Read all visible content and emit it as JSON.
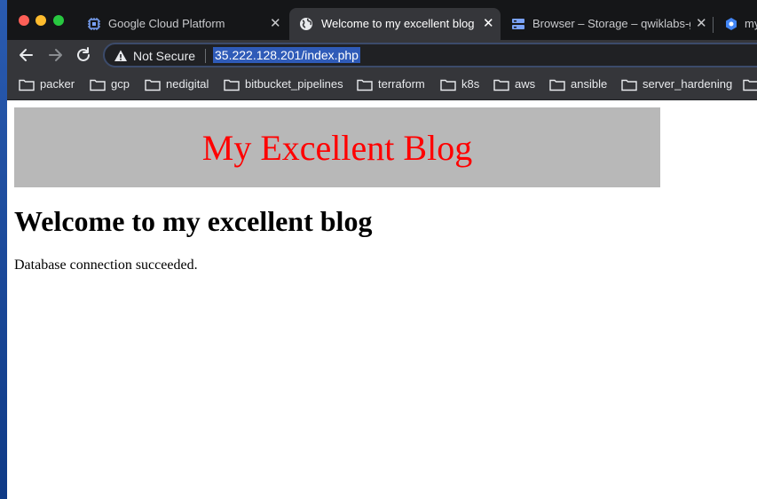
{
  "browser": {
    "tabs": [
      {
        "title": "Google Cloud Platform",
        "icon": "chip-icon",
        "active": false
      },
      {
        "title": "Welcome to my excellent blog",
        "icon": "globe-icon",
        "active": true
      },
      {
        "title": "Browser – Storage – qwiklabs-g",
        "icon": "storage-icon",
        "active": false
      },
      {
        "title": "my",
        "icon": "hexagon-icon",
        "active": false
      }
    ],
    "close_glyph": "✕",
    "security_label": "Not Secure",
    "url": "35.222.128.201/index.php",
    "colors": {
      "tabstrip_bg": "#151618",
      "toolbar_bg": "#35363a",
      "url_highlight": "#2f5bb8"
    }
  },
  "bookmarks": [
    {
      "label": "packer"
    },
    {
      "label": "gcp"
    },
    {
      "label": "nedigital"
    },
    {
      "label": "bitbucket_pipelines"
    },
    {
      "label": "terraform"
    },
    {
      "label": "k8s"
    },
    {
      "label": "aws"
    },
    {
      "label": "ansible"
    },
    {
      "label": "server_hardening"
    }
  ],
  "page": {
    "banner_title": "My Excellent Blog",
    "heading": "Welcome to my excellent blog",
    "status": "Database connection succeeded.",
    "colors": {
      "banner_bg": "#b8b8b8",
      "banner_text": "#ff0000"
    }
  }
}
